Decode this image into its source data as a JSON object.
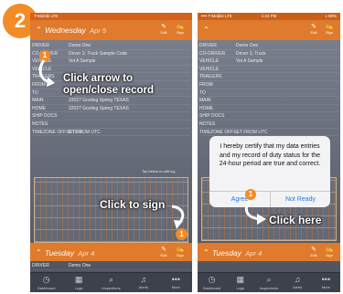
{
  "step_number": "2",
  "left": {
    "status": {
      "carrier": "T-Mobile  LTE",
      "time": "",
      "battery": ""
    },
    "day_header": {
      "chevron": "⌃",
      "day": "Wednesday",
      "date": "Apr 5",
      "edit_label": "Edit",
      "sign_label": "Sign"
    },
    "rows": [
      {
        "key": "DRIVER",
        "value": "Demo One"
      },
      {
        "key": "CO-DRIVER",
        "value": "Driver 3, Truck Sample Code"
      },
      {
        "key": "VEHICLE",
        "value": "Vol A Sample"
      },
      {
        "key": "VEHICLE",
        "value": ""
      },
      {
        "key": "TRAILERS",
        "value": ""
      },
      {
        "key": "FROM",
        "value": ""
      },
      {
        "key": "TO",
        "value": ""
      },
      {
        "key": "MAIN",
        "value": "22027 Gosling Spring TEXAS"
      },
      {
        "key": "HOME",
        "value": "22027 Gosling Spring TEXAS"
      },
      {
        "key": "SHIP DOCS",
        "value": ""
      },
      {
        "key": "NOTES",
        "value": ""
      },
      {
        "key": "TIMEZONE OFFSET FROM UTC",
        "value": "UTC-5"
      }
    ],
    "grid_hint": "Tap below to edit log",
    "second_day": {
      "chevron": "⌃",
      "day": "Tuesday",
      "date": "Apr 4",
      "edit_label": "Edit",
      "sign_label": "Sign"
    },
    "bottom_row": {
      "key": "DRIVER",
      "value": "Demo One"
    },
    "callout_arrow": "Click arrow to\nopen/close record",
    "callout_sign": "Click to sign",
    "badge_1": "1",
    "badge_2": "1"
  },
  "right": {
    "status": {
      "carrier": "•••• T-Mobile  LTE",
      "time": "1:24 PM",
      "battery": "◑ 98%"
    },
    "day_header": {
      "chevron": "⌃",
      "day": "",
      "date": "",
      "edit_label": "Edit",
      "sign_label": "Sign"
    },
    "rows": [
      {
        "key": "DRIVER",
        "value": "Demo One"
      },
      {
        "key": "CO-DRIVER",
        "value": "Driver 3, Truck"
      },
      {
        "key": "VEHICLE",
        "value": "Vol A Sample"
      },
      {
        "key": "VEHICLE",
        "value": ""
      },
      {
        "key": "TRAILERS",
        "value": ""
      },
      {
        "key": "FROM",
        "value": ""
      },
      {
        "key": "TO",
        "value": ""
      },
      {
        "key": "MAIN",
        "value": ""
      },
      {
        "key": "HOME",
        "value": ""
      },
      {
        "key": "SHIP DOCS",
        "value": ""
      },
      {
        "key": "NOTES",
        "value": ""
      },
      {
        "key": "TIMEZONE OFFSET FROM UTC",
        "value": ""
      }
    ],
    "dialog": {
      "message": "I hereby certify that my data entries and my record of duty status for the 24-hour period are true and correct.",
      "agree": "Agree",
      "not_ready": "Not Ready"
    },
    "second_day": {
      "chevron": "⌃",
      "day": "Tuesday",
      "date": "Apr 4",
      "edit_label": "Edit",
      "sign_label": "Sign"
    },
    "callout_here": "Click here",
    "badge": "1"
  },
  "tabs": [
    {
      "icon": "◷",
      "label": "Dashboard"
    },
    {
      "icon": "▦",
      "label": "Logs"
    },
    {
      "icon": "⌕",
      "label": "Inspections"
    },
    {
      "icon": "♫",
      "label": "Alerts"
    },
    {
      "icon": "•••",
      "label": "More"
    }
  ],
  "colors": {
    "accent": "#f28c26",
    "header": "#e07a2c",
    "dialog_link": "#1f7ae0"
  }
}
